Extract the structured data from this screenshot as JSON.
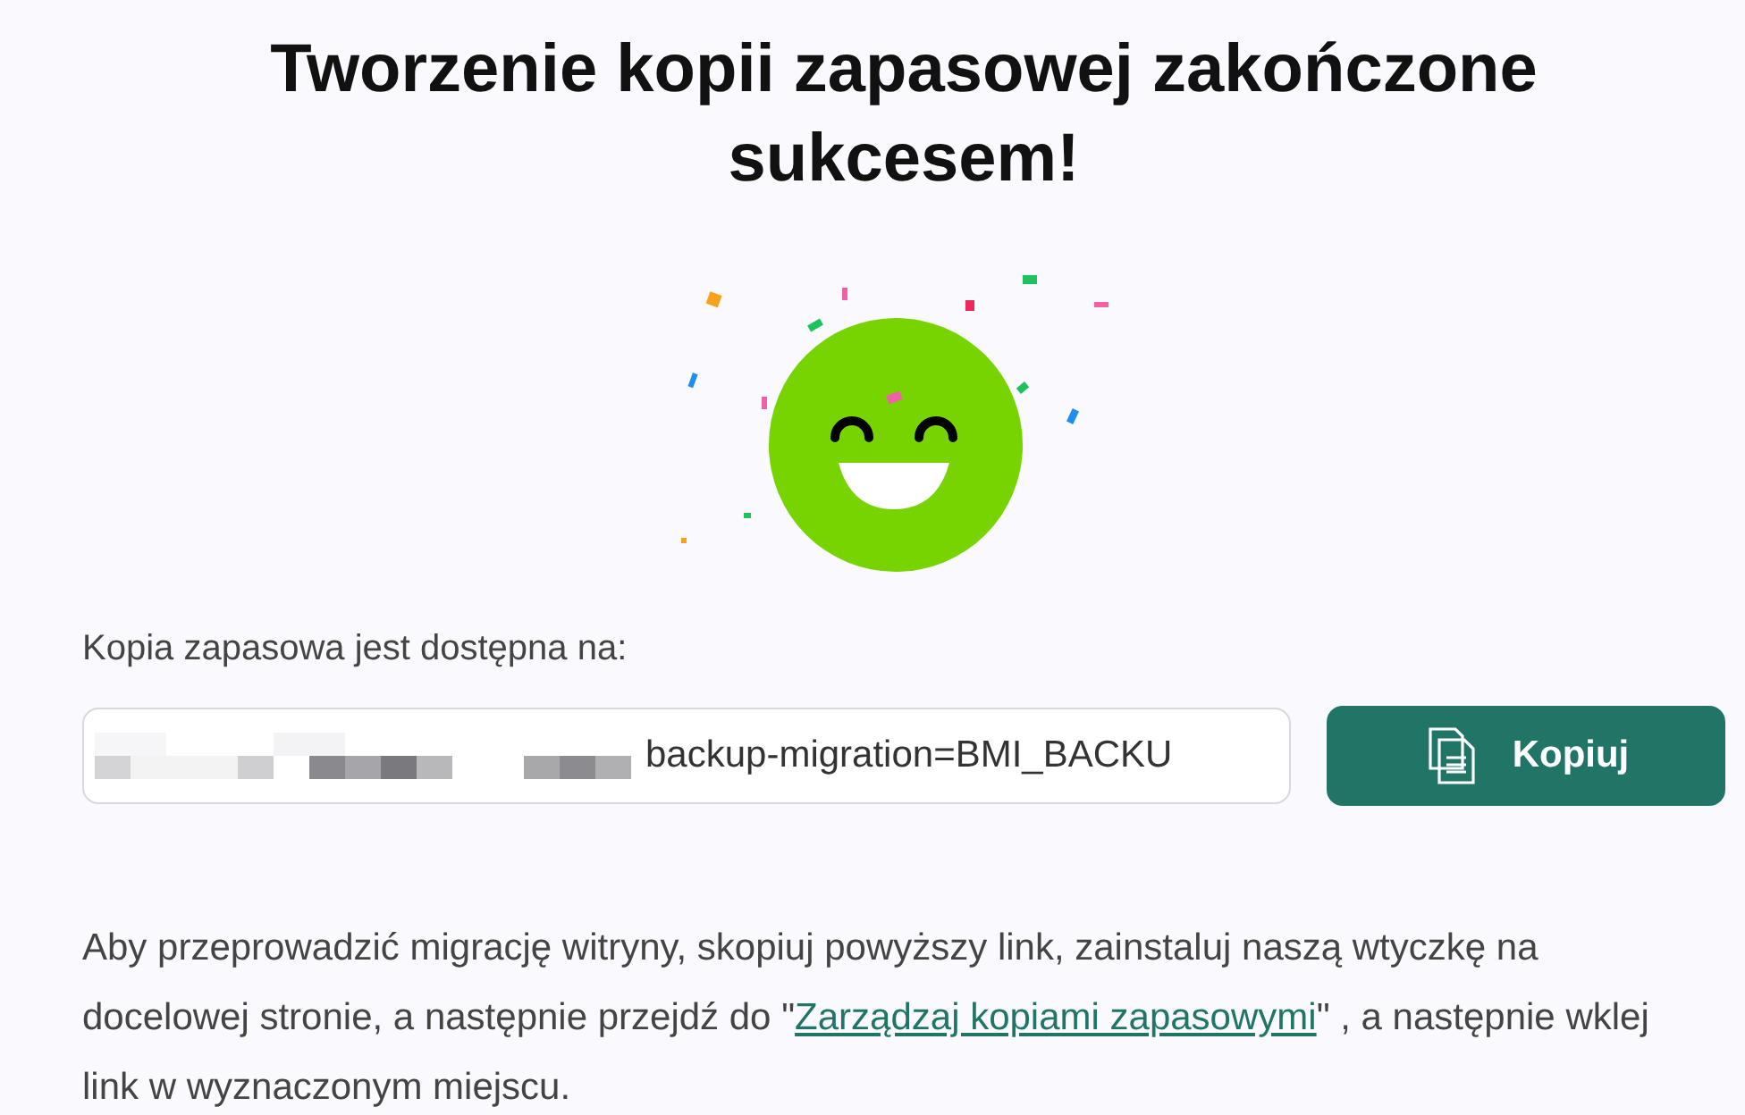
{
  "title": "Tworzenie kopii zapasowej zakończone sukcesem!",
  "location_label": "Kopia zapasowa jest dostępna na:",
  "link_field": {
    "value": "backup-migration=BMI_BACKU"
  },
  "copy_button": {
    "label": "Kopiuj"
  },
  "instructions": {
    "before": "Aby przeprowadzić migrację witryny, skopiuj powyższy link, zainstaluj naszą wtyczkę na docelowej stronie, a następnie przejdź do \"",
    "link": "Zarządzaj kopiami zapasowymi",
    "after": "\" , a następnie wklej link w wyznaczonym miejscu."
  }
}
